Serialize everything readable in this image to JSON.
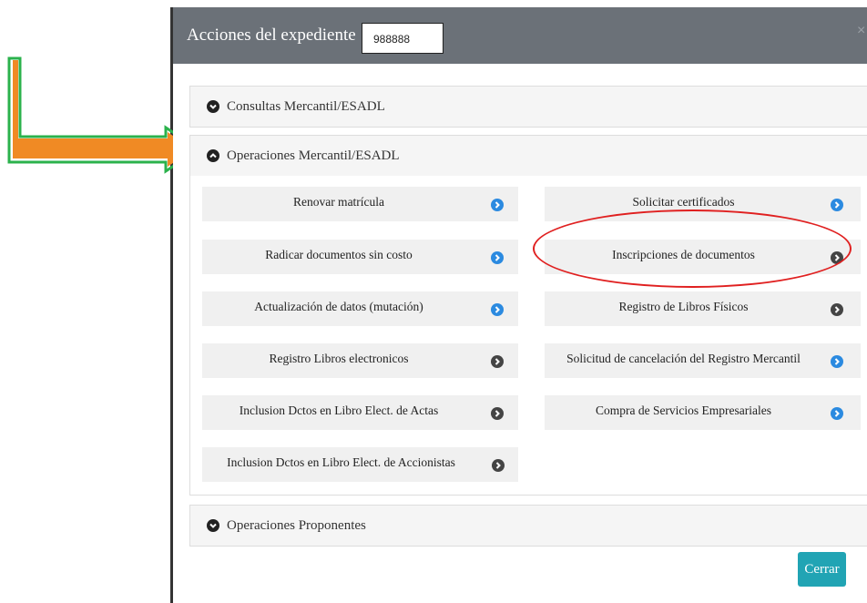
{
  "modal": {
    "title": "Acciones del expediente",
    "expediente_id": "988888",
    "close_symbol": "×"
  },
  "sections": {
    "consultas": {
      "label": "Consultas Mercantil/ESADL",
      "state": "collapsed"
    },
    "operaciones": {
      "label": "Operaciones Mercantil/ESADL",
      "state": "expanded",
      "buttons": [
        {
          "label": "Renovar matrícula",
          "icon": "chevron-right-circle-icon",
          "icon_color": "#2b8ae0"
        },
        {
          "label": "Solicitar certificados",
          "icon": "chevron-right-circle-icon",
          "icon_color": "#2b8ae0"
        },
        {
          "label": "Radicar documentos sin costo",
          "icon": "chevron-right-circle-icon",
          "icon_color": "#2b8ae0"
        },
        {
          "label": "Inscripciones de documentos",
          "icon": "chevron-right-circle-icon",
          "icon_color": "#444444"
        },
        {
          "label": "Actualización de datos (mutación)",
          "icon": "chevron-right-circle-icon",
          "icon_color": "#2b8ae0"
        },
        {
          "label": "Registro de Libros Físicos",
          "icon": "chevron-right-circle-icon",
          "icon_color": "#444444"
        },
        {
          "label": "Registro Libros electronicos",
          "icon": "chevron-right-circle-icon",
          "icon_color": "#444444"
        },
        {
          "label": "Solicitud de cancelación del Registro Mercantil",
          "icon": "chevron-right-circle-icon",
          "icon_color": "#2b8ae0"
        },
        {
          "label": "Inclusion Dctos en Libro Elect. de Actas",
          "icon": "chevron-right-circle-icon",
          "icon_color": "#444444"
        },
        {
          "label": "Compra de Servicios Empresariales",
          "icon": "chevron-right-circle-icon",
          "icon_color": "#2b8ae0"
        },
        {
          "label": "Inclusion Dctos en Libro Elect. de Accionistas",
          "icon": "chevron-right-circle-icon",
          "icon_color": "#444444"
        }
      ]
    },
    "proponentes": {
      "label": "Operaciones Proponentes",
      "state": "collapsed"
    }
  },
  "footer": {
    "close_label": "Cerrar"
  },
  "colors": {
    "header_bg": "#6b7178",
    "primary_button": "#21a4b4",
    "annotation_arrow_fill": "#f08a24",
    "annotation_arrow_stroke": "#2bb24c",
    "annotation_ellipse": "#e02020"
  }
}
